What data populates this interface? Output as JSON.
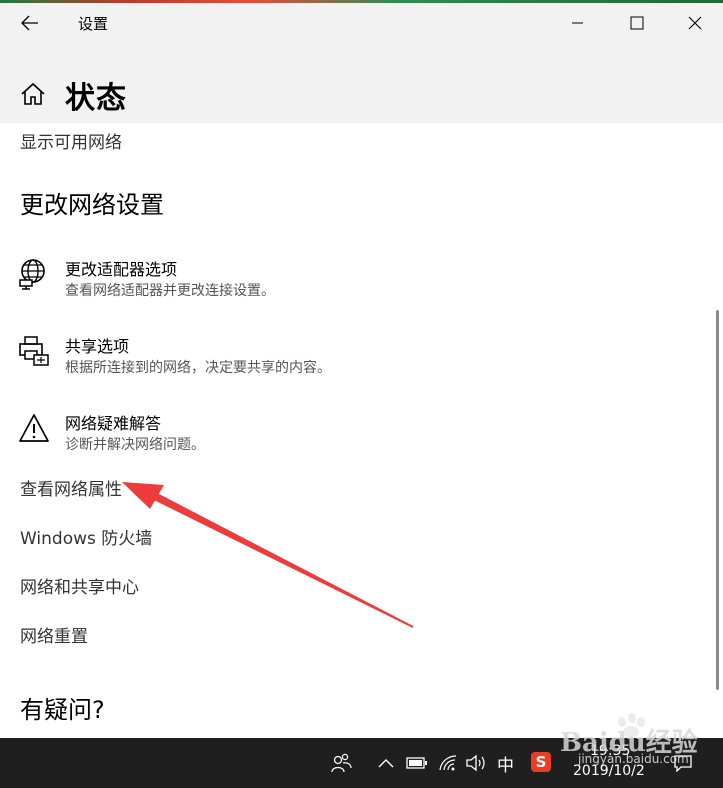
{
  "window": {
    "title": "设置",
    "page_title": "状态"
  },
  "content": {
    "top_link": "显示可用网络",
    "section_title": "更改网络设置",
    "items": [
      {
        "title": "更改适配器选项",
        "desc": "查看网络适配器并更改连接设置。",
        "icon": "adapter-globe-icon"
      },
      {
        "title": "共享选项",
        "desc": "根据所连接到的网络，决定要共享的内容。",
        "icon": "printer-share-icon"
      },
      {
        "title": "网络疑难解答",
        "desc": "诊断并解决网络问题。",
        "icon": "warning-triangle-icon"
      }
    ],
    "links": [
      "查看网络属性",
      "Windows 防火墙",
      "网络和共享中心",
      "网络重置"
    ],
    "question_title": "有疑问?"
  },
  "taskbar": {
    "ime": "中",
    "sogou": "S",
    "time": "19:35",
    "date": "2019/10/2"
  },
  "watermark": {
    "brand": "Baidu经验",
    "url": "jingyan.baidu.com"
  },
  "colors": {
    "arrow": "#ee3b3b",
    "taskbar": "#1f1f1f",
    "header": "#f2f2f2"
  }
}
